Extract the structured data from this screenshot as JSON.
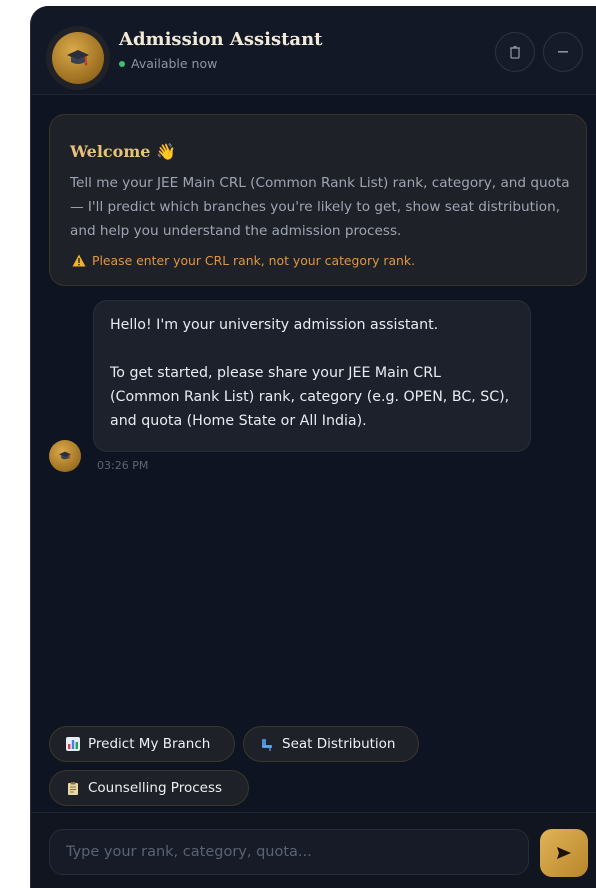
{
  "header": {
    "title": "Admission Assistant",
    "status": "Available now",
    "status_color": "#3cbf73",
    "actions": [
      "trash-icon",
      "minimize-icon"
    ]
  },
  "welcome": {
    "title": "Welcome",
    "emoji": "👋",
    "text": "Tell me your JEE Main CRL (Common Rank List) rank, category, and quota — I'll predict which branches you're likely to get, show seat distribution, and help you understand the admission process.",
    "warning": "Please enter your CRL rank, not your category rank."
  },
  "messages": [
    {
      "sender": "assistant",
      "line1": "Hello! I'm your university admission assistant.",
      "line2": "To get started, please share your JEE Main CRL (Common Rank List) rank, category (e.g. OPEN, BC, SC), and quota (Home State or All India).",
      "time": "03:26 PM"
    }
  ],
  "quick_actions": [
    {
      "label": "Predict My Branch",
      "icon": "bar-chart-icon"
    },
    {
      "label": "Seat Distribution",
      "icon": "seat-icon"
    },
    {
      "label": "Counselling Process",
      "icon": "clipboard-icon"
    }
  ],
  "composer": {
    "placeholder": "Type your rank, category, quota...",
    "value": ""
  },
  "colors": {
    "accent": "#d9a94a",
    "background": "#0f1422",
    "warning": "#e2953a"
  }
}
